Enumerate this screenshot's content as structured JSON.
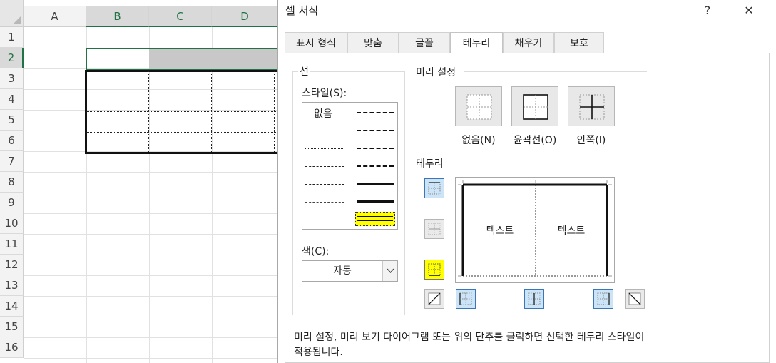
{
  "sheet": {
    "columns": [
      "A",
      "B",
      "C",
      "D"
    ],
    "rows": [
      "1",
      "2",
      "3",
      "4",
      "5",
      "6",
      "7",
      "8",
      "9",
      "10",
      "11",
      "12",
      "13",
      "14",
      "15",
      "16"
    ]
  },
  "dialog": {
    "title": "셀 서식",
    "help": "?",
    "close": "✕",
    "tabs": [
      "표시 형식",
      "맞춤",
      "글꼴",
      "테두리",
      "채우기",
      "보호"
    ],
    "line_group": {
      "title": "선",
      "style_label": "스타일(S):",
      "none_label": "없음",
      "color_label": "색(C):",
      "color_value": "자동",
      "highlight_color": "#ffff00"
    },
    "presets": {
      "title": "미리 설정",
      "items": [
        "없음(N)",
        "윤곽선(O)",
        "안쪽(I)"
      ]
    },
    "border": {
      "title": "테두리",
      "preview_text": [
        "텍스트",
        "텍스트"
      ]
    },
    "hint": [
      "미리 설정, 미리 보기 다이어그램 또는 위의 단추를 클릭하면 선택한 테두리 스타일이",
      "적용됩니다."
    ]
  },
  "colors": {
    "excel_green": "#217346",
    "selected_blue": "#cce4f7",
    "highlight_yellow": "#ffff00"
  }
}
